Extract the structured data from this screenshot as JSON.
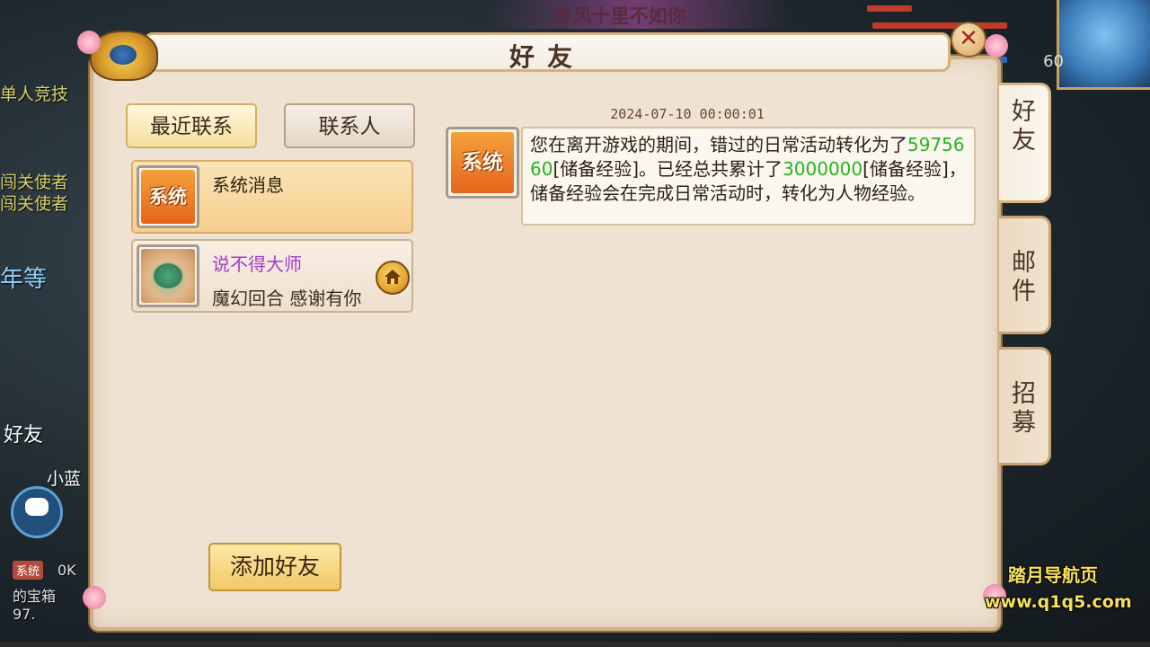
{
  "background": {
    "top_banner_text": "春风十里不如你",
    "level_text": "60",
    "left_texts": [
      "单人竞技",
      "闯关使者",
      "闯关使者",
      "年等"
    ],
    "left_bottom_name": "小蓝",
    "left_bottom_tag": "好友",
    "chat_badge": "系统",
    "chat_lines": [
      "0K",
      "的宝箱",
      "97."
    ]
  },
  "dialog": {
    "title": "好友",
    "close_label": "✕"
  },
  "left_panel": {
    "tab_recent": "最近联系",
    "tab_contacts": "联系人",
    "contacts": [
      {
        "avatar_text": "系统",
        "name": "系统消息",
        "subtitle": ""
      },
      {
        "name": "说不得大师",
        "subtitle": "魔幻回合 感谢有你",
        "name_color": "#a23cc8",
        "action_icon": "home-icon"
      }
    ],
    "add_friend_label": "添加好友"
  },
  "message": {
    "timestamp": "2024-07-10 00:00:01",
    "avatar_text": "系统",
    "text_part1": "您在离开游戏的期间，错过的日常活动转化为了",
    "value1": "5975660",
    "text_part2": "[储备经验]。已经总共累计了",
    "value2": "3000000",
    "text_part3": "[储备经验]，储备经验会在完成日常活动时，转化为人物经验。",
    "highlight_color": "#26b41f"
  },
  "side_tabs": [
    {
      "label": "好友",
      "active": true
    },
    {
      "label": "邮件",
      "active": false
    },
    {
      "label": "招募",
      "active": false
    }
  ],
  "watermark": {
    "line1": "踏月导航页",
    "line2": "www.q1q5.com"
  }
}
